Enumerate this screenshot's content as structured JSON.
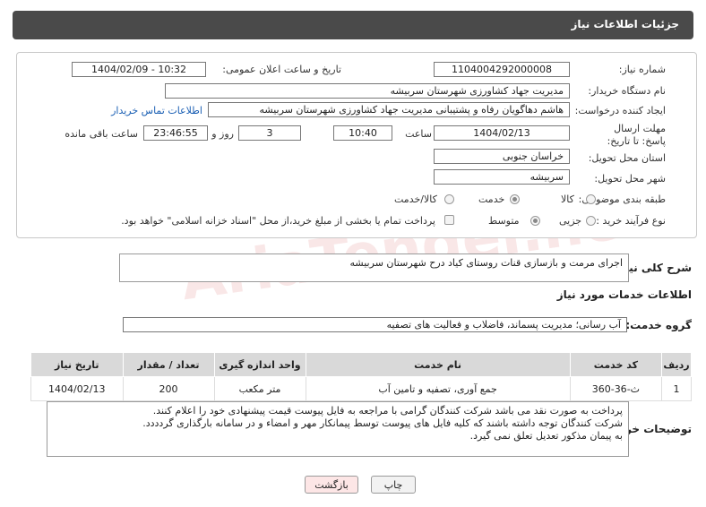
{
  "header": {
    "title": "جزئیات اطلاعات نیاز"
  },
  "form": {
    "need_number_label": "شماره نیاز:",
    "need_number": "1104004292000008",
    "announce_label": "تاریخ و ساعت اعلان عمومی:",
    "announce_value": "1404/02/09 - 10:32",
    "buyer_org_label": "نام دستگاه خریدار:",
    "buyer_org": "مدیریت جهاد کشاورزی شهرستان سربیشه",
    "creator_label": "ایجاد کننده درخواست:",
    "creator": "هاشم دهاگویان  رفاه و پشتیبانی مدیریت جهاد کشاورزی شهرستان سربیشه",
    "contact_link": "اطلاعات تماس خریدار",
    "deadline_label": "مهلت ارسال پاسخ: تا تاریخ:",
    "deadline_date": "1404/02/13",
    "time_label": "ساعت",
    "deadline_time": "10:40",
    "days_value": "3",
    "days_label": "روز و",
    "remaining_time": "23:46:55",
    "remaining_label": "ساعت باقی مانده",
    "province_label": "استان محل تحویل:",
    "province": "خراسان جنوبی",
    "city_label": "شهر محل تحویل:",
    "city": "سربیشه",
    "category_label": "طبقه بندی موضوعی:",
    "category_options": [
      "کالا",
      "خدمت",
      "کالا/خدمت"
    ],
    "category_selected": "خدمت",
    "process_label": "نوع فرآیند خرید :",
    "process_options": [
      "جزیی",
      "متوسط"
    ],
    "process_selected": "متوسط",
    "payment_note": "پرداخت تمام یا بخشی از مبلغ خرید،از محل \"اسناد خزانه اسلامی\" خواهد بود."
  },
  "summary": {
    "label": "شرح کلی نیاز:",
    "value": "اجرای مرمت و بازسازی قنات روستای کیاد درح شهرستان سربیشه"
  },
  "services": {
    "section_title": "اطلاعات خدمات مورد نیاز",
    "group_label": "گروه خدمت:",
    "group_value": "آب رسانی؛ مدیریت پسماند، فاضلاب و فعالیت های تصفیه",
    "columns": [
      "ردیف",
      "کد خدمت",
      "نام خدمت",
      "واحد اندازه گیری",
      "تعداد / مقدار",
      "تاریخ نیاز"
    ],
    "rows": [
      {
        "row": "1",
        "code": "ث-36-360",
        "name": "جمع آوری، تصفیه و تامین آب",
        "unit": "متر مکعب",
        "qty": "200",
        "date": "1404/02/13"
      }
    ]
  },
  "notes": {
    "label": "توضیحات خریدار:",
    "line1": "پرداخت به صورت نقد می باشد شرکت کنندگان گرامی با مراجعه به فایل پیوست قیمت پیشنهادی خود را اعلام کنند.",
    "line2": "شرکت کنندگان توجه داشته باشند که کلیه فایل های پیوست توسط پیمانکار مهر و امضاء و در سامانه بارگذاری گردددد.",
    "line3": "به پیمان مذکور تعدیل تعلق نمی گیرد."
  },
  "buttons": {
    "print": "چاپ",
    "back": "بازگشت"
  },
  "watermark": "AriaTender.net"
}
